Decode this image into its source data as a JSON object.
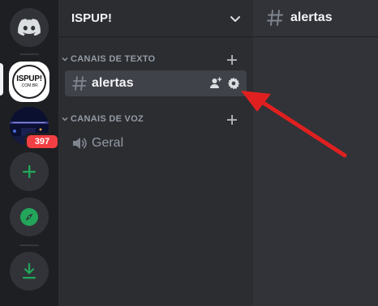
{
  "server_rail": {
    "ispup_icon": {
      "name": "ISPUP!",
      "url": ".COM.BR"
    },
    "banner_badge": "397"
  },
  "sidebar": {
    "guild_name": "ISPUP!",
    "categories": [
      {
        "label": "CANAIS DE TEXTO",
        "channels": [
          {
            "name": "alertas",
            "type": "text",
            "active": true
          }
        ]
      },
      {
        "label": "CANAIS DE VOZ",
        "channels": [
          {
            "name": "Geral",
            "type": "voice",
            "active": false
          }
        ]
      }
    ]
  },
  "main": {
    "channel_title": "alertas"
  },
  "annotation": {
    "color": "#e02020",
    "points_to": "channel-settings-icon"
  },
  "colors": {
    "rail_bg": "#1e1f22",
    "sidebar_bg": "#2b2d31",
    "main_bg": "#313338",
    "accent_green": "#23a55a",
    "discord_blurple": "#5865f2",
    "badge_red": "#f23f43"
  }
}
